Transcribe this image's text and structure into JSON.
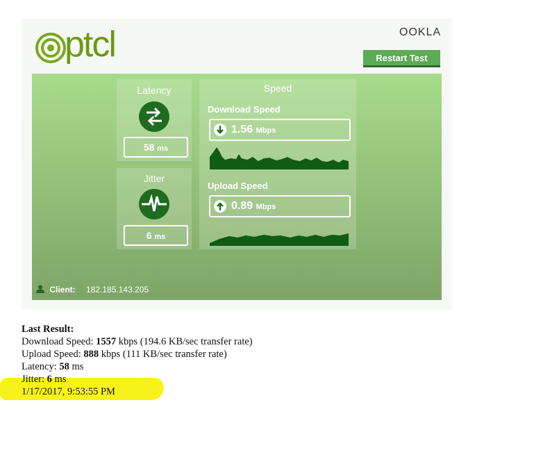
{
  "brand": {
    "name": "ptcl",
    "provider": "OOKLA"
  },
  "header": {
    "restart_label": "Restart Test"
  },
  "latency": {
    "title": "Latency",
    "value": "58",
    "unit": "ms"
  },
  "jitter": {
    "title": "Jitter",
    "value": "6",
    "unit": "ms"
  },
  "speed": {
    "title": "Speed",
    "download": {
      "label": "Download Speed",
      "value": "1.56",
      "unit": "Mbps"
    },
    "upload": {
      "label": "Upload Speed",
      "value": "0.89",
      "unit": "Mbps"
    }
  },
  "client": {
    "label": "Client:",
    "ip": "182.185.143.205"
  },
  "last_result": {
    "heading": "Last Result:",
    "download_prefix": "Download Speed: ",
    "download_value": "1557",
    "download_suffix": " kbps (194.6 KB/sec transfer rate)",
    "upload_prefix": "Upload Speed: ",
    "upload_value": "888",
    "upload_suffix": " kbps (111 KB/sec transfer rate)",
    "latency_prefix": "Latency: ",
    "latency_value": "58",
    "latency_suffix": " ms",
    "jitter_prefix": "Jitter: ",
    "jitter_value": "6",
    "jitter_suffix": " ms",
    "timestamp": "1/17/2017, 9:53:55 PM"
  },
  "colors": {
    "accent": "#5cab55",
    "dark_green": "#1f6b1f",
    "highlight": "#f7f21a"
  },
  "icons": [
    "arrows-exchange-icon",
    "pulse-icon",
    "download-arrow-icon",
    "upload-arrow-icon",
    "user-icon"
  ]
}
